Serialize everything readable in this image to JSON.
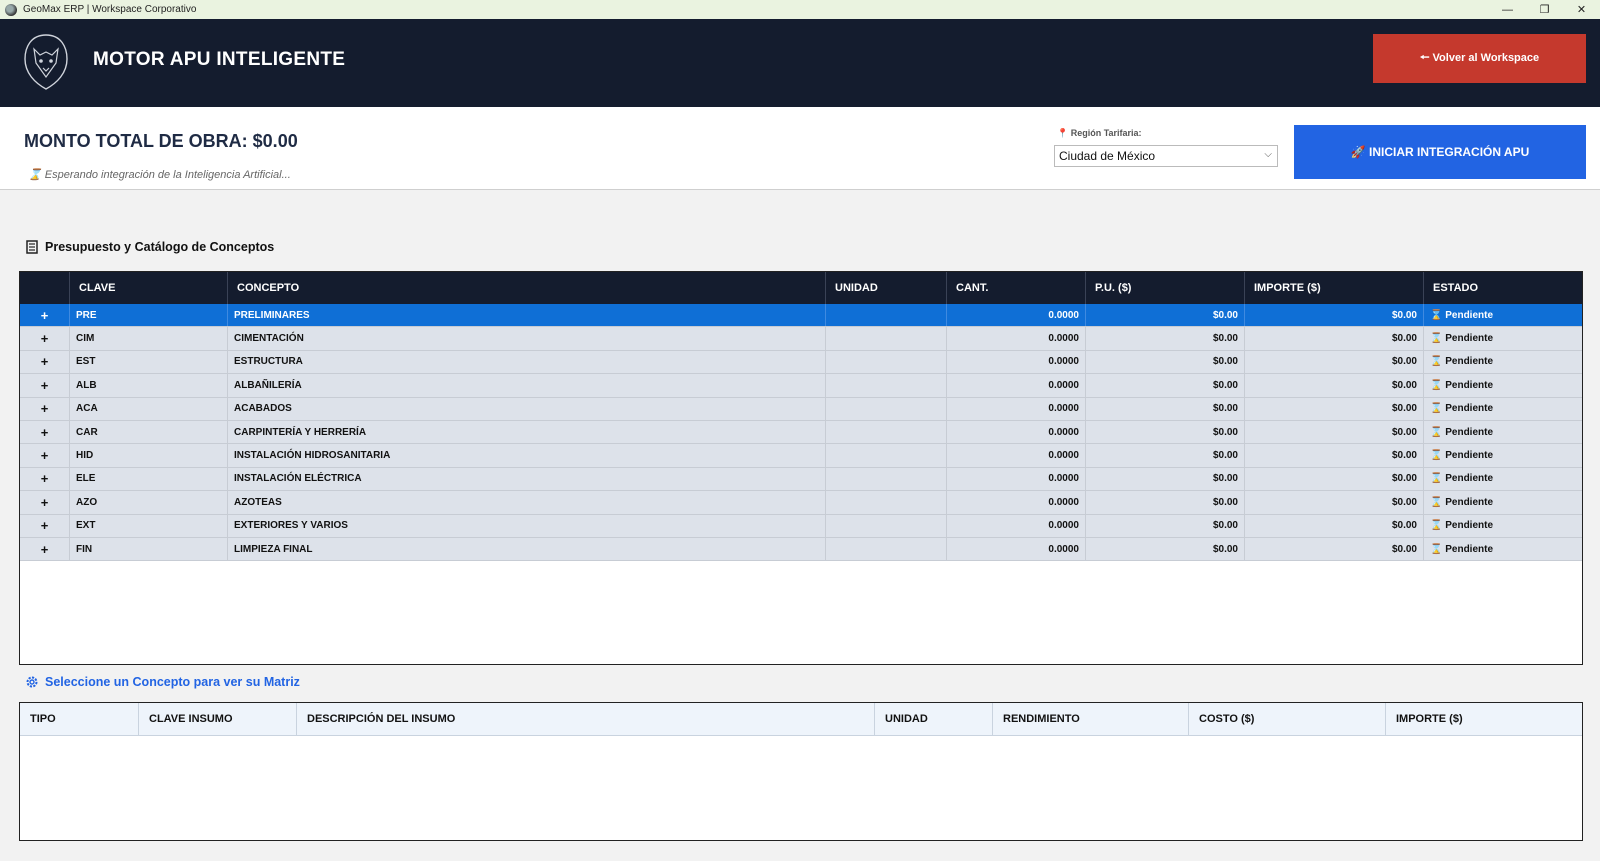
{
  "window": {
    "title": "GeoMax ERP | Workspace Corporativo",
    "controls": {
      "minimize": "—",
      "restore": "❐",
      "close": "✕"
    }
  },
  "header": {
    "title": "MOTOR APU INTELIGENTE",
    "back_button": "🠔 Volver al Workspace"
  },
  "info": {
    "total": "MONTO TOTAL DE OBRA: $0.00",
    "status": "⌛ Esperando integración de la Inteligencia Artificial...",
    "region_label": "📍 Región Tarifaria:",
    "region_value": "Ciudad de México",
    "apu_button": "🚀 INICIAR INTEGRACIÓN APU"
  },
  "budget": {
    "title": "Presupuesto y Catálogo de Conceptos",
    "columns": [
      "",
      "CLAVE",
      "CONCEPTO",
      "UNIDAD",
      "CANT.",
      "P.U. ($)",
      "IMPORTE ($)",
      "ESTADO"
    ],
    "rows": [
      {
        "expand": "+",
        "clave": "PRE",
        "concepto": "PRELIMINARES",
        "unidad": "",
        "cant": "0.0000",
        "pu": "$0.00",
        "importe": "$0.00",
        "estado": "⌛ Pendiente"
      },
      {
        "expand": "+",
        "clave": "CIM",
        "concepto": "CIMENTACIÓN",
        "unidad": "",
        "cant": "0.0000",
        "pu": "$0.00",
        "importe": "$0.00",
        "estado": "⌛ Pendiente"
      },
      {
        "expand": "+",
        "clave": "EST",
        "concepto": "ESTRUCTURA",
        "unidad": "",
        "cant": "0.0000",
        "pu": "$0.00",
        "importe": "$0.00",
        "estado": "⌛ Pendiente"
      },
      {
        "expand": "+",
        "clave": "ALB",
        "concepto": "ALBAÑILERÍA",
        "unidad": "",
        "cant": "0.0000",
        "pu": "$0.00",
        "importe": "$0.00",
        "estado": "⌛ Pendiente"
      },
      {
        "expand": "+",
        "clave": "ACA",
        "concepto": "ACABADOS",
        "unidad": "",
        "cant": "0.0000",
        "pu": "$0.00",
        "importe": "$0.00",
        "estado": "⌛ Pendiente"
      },
      {
        "expand": "+",
        "clave": "CAR",
        "concepto": "CARPINTERÍA Y HERRERÍA",
        "unidad": "",
        "cant": "0.0000",
        "pu": "$0.00",
        "importe": "$0.00",
        "estado": "⌛ Pendiente"
      },
      {
        "expand": "+",
        "clave": "HID",
        "concepto": "INSTALACIÓN HIDROSANITARIA",
        "unidad": "",
        "cant": "0.0000",
        "pu": "$0.00",
        "importe": "$0.00",
        "estado": "⌛ Pendiente"
      },
      {
        "expand": "+",
        "clave": "ELE",
        "concepto": "INSTALACIÓN ELÉCTRICA",
        "unidad": "",
        "cant": "0.0000",
        "pu": "$0.00",
        "importe": "$0.00",
        "estado": "⌛ Pendiente"
      },
      {
        "expand": "+",
        "clave": "AZO",
        "concepto": "AZOTEAS",
        "unidad": "",
        "cant": "0.0000",
        "pu": "$0.00",
        "importe": "$0.00",
        "estado": "⌛ Pendiente"
      },
      {
        "expand": "+",
        "clave": "EXT",
        "concepto": "EXTERIORES Y VARIOS",
        "unidad": "",
        "cant": "0.0000",
        "pu": "$0.00",
        "importe": "$0.00",
        "estado": "⌛ Pendiente"
      },
      {
        "expand": "+",
        "clave": "FIN",
        "concepto": "LIMPIEZA FINAL",
        "unidad": "",
        "cant": "0.0000",
        "pu": "$0.00",
        "importe": "$0.00",
        "estado": "⌛ Pendiente"
      }
    ]
  },
  "matrix": {
    "title": "Seleccione un Concepto para ver su Matriz",
    "columns": [
      "TIPO",
      "CLAVE INSUMO",
      "DESCRIPCIÓN DEL INSUMO",
      "UNIDAD",
      "RENDIMIENTO",
      "COSTO ($)",
      "IMPORTE ($)"
    ]
  },
  "colors": {
    "header_bg": "#141c2e",
    "back_button": "#c5392d",
    "primary": "#2264e3",
    "selected_row": "#0f6fd6",
    "row_bg": "#dde2ea"
  }
}
